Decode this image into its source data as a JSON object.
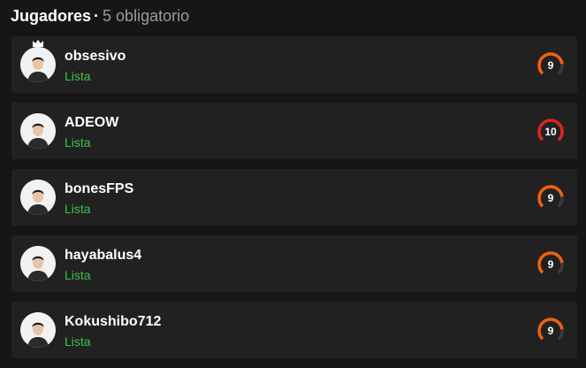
{
  "header": {
    "title": "Jugadores",
    "separator": "·",
    "subtitle": "5 obligatorio"
  },
  "colors": {
    "status_ready": "#3cc24a",
    "level_orange": "#f2600c",
    "level_red": "#e1231b"
  },
  "players": [
    {
      "name": "obsesivo",
      "status": "Lista",
      "level": 9,
      "level_color": "#f2600c",
      "level_fraction": 0.8,
      "has_crown": true,
      "avatar_icon": "player-avatar-icon"
    },
    {
      "name": "ADEOW",
      "status": "Lista",
      "level": 10,
      "level_color": "#e1231b",
      "level_fraction": 1.0,
      "has_crown": false,
      "avatar_icon": "player-avatar-icon"
    },
    {
      "name": "bonesFPS",
      "status": "Lista",
      "level": 9,
      "level_color": "#f2600c",
      "level_fraction": 0.8,
      "has_crown": false,
      "avatar_icon": "player-avatar-icon"
    },
    {
      "name": "hayabalus4",
      "status": "Lista",
      "level": 9,
      "level_color": "#f2600c",
      "level_fraction": 0.8,
      "has_crown": false,
      "avatar_icon": "player-avatar-icon"
    },
    {
      "name": "Kokushibo712",
      "status": "Lista",
      "level": 9,
      "level_color": "#f2600c",
      "level_fraction": 0.8,
      "has_crown": false,
      "avatar_icon": "player-avatar-icon"
    }
  ]
}
